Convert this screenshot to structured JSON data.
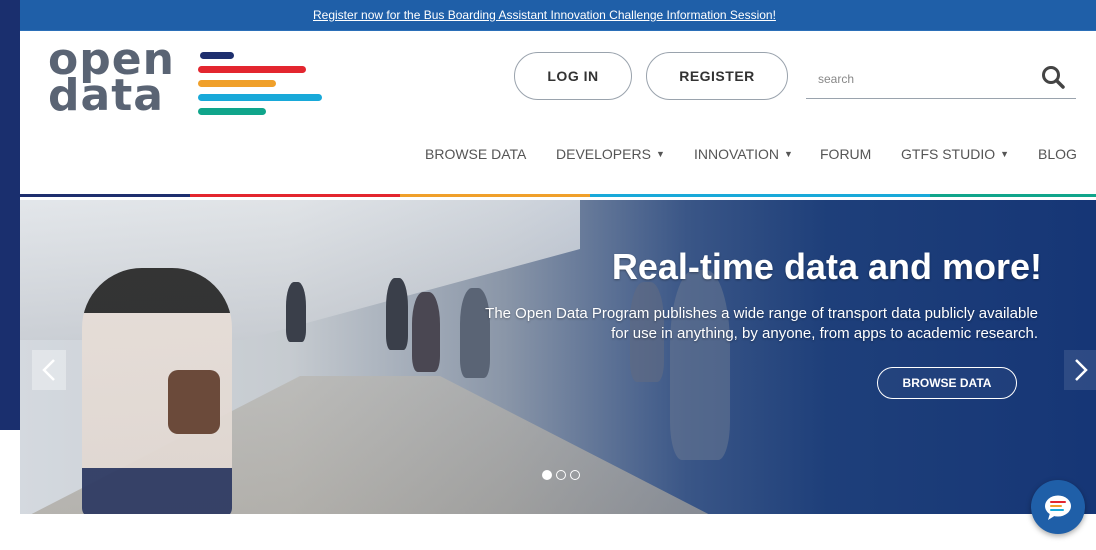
{
  "announcement": {
    "text": "Register now for the Bus Boarding Assistant Innovation Challenge Information Session!"
  },
  "logo": {
    "line1": "open",
    "line2": "data"
  },
  "header": {
    "login_label": "LOG IN",
    "register_label": "REGISTER",
    "search_placeholder": "search"
  },
  "nav": {
    "items": [
      {
        "label": "BROWSE DATA",
        "has_dropdown": false
      },
      {
        "label": "DEVELOPERS",
        "has_dropdown": true
      },
      {
        "label": "INNOVATION",
        "has_dropdown": true
      },
      {
        "label": "FORUM",
        "has_dropdown": false
      },
      {
        "label": "GTFS STUDIO",
        "has_dropdown": true
      },
      {
        "label": "BLOG",
        "has_dropdown": false
      }
    ],
    "dropdown_glyph": "▼"
  },
  "hero": {
    "title": "Real-time data and more!",
    "body": "The Open Data Program publishes a wide range of transport data publicly available for use in anything, by anyone, from apps to academic research.",
    "cta_label": "BROWSE DATA",
    "slides": 3,
    "active_slide": 1
  },
  "icons": {
    "search": "search-icon",
    "prev": "chevron-left-icon",
    "next": "chevron-right-icon",
    "chat": "chat-bubble-icon"
  },
  "colors": {
    "topbar": "#1f5fa8",
    "logo_text": "#5a6474",
    "stripe_navy": "#1e2f6e",
    "stripe_red": "#e3262f",
    "stripe_orange": "#f0a02a",
    "stripe_cyan": "#18a9d9",
    "stripe_teal": "#10a58b",
    "hero_blue": "#163676"
  }
}
